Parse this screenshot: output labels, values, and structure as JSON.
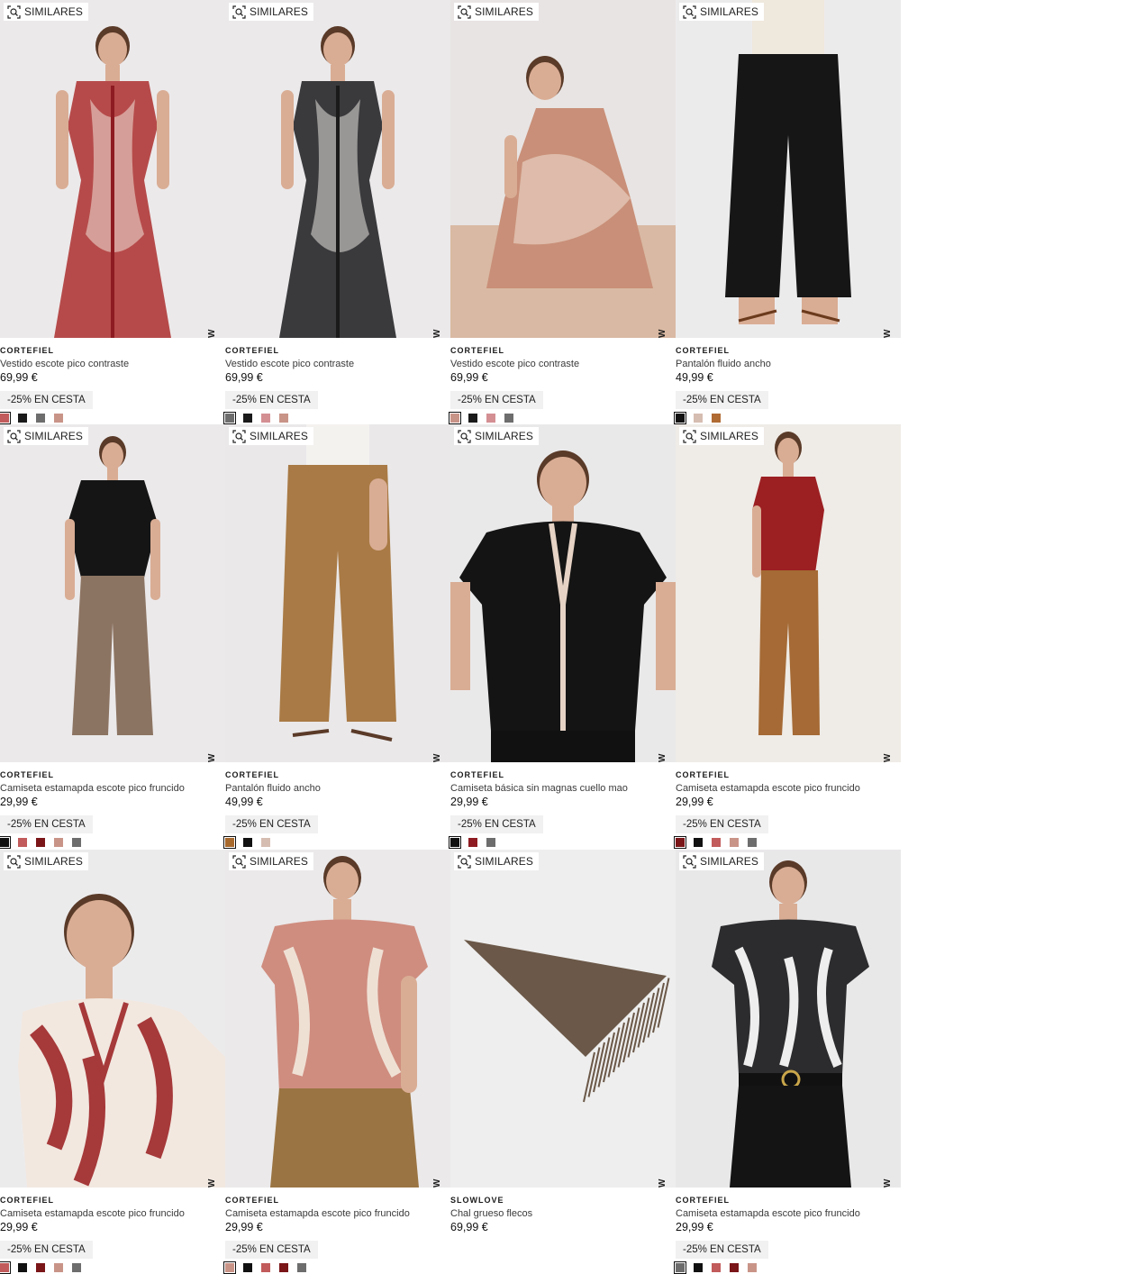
{
  "common": {
    "similar_label": "SIMILARES",
    "new_label": "NEW",
    "promo_label": "-25% EN CESTA"
  },
  "products": [
    {
      "brand": "CORTEFIEL",
      "name": "Vestido escote pico contraste",
      "price": "69,99 €",
      "promo": true,
      "scene": {
        "bg": "#ece9ea",
        "garment": "dress-red-print",
        "main": "#b64a4a",
        "second": "#f1e3d8"
      },
      "swatches": [
        "#c25b5b",
        "#1a1a1a",
        "#6d6d6d",
        "#c99488"
      ]
    },
    {
      "brand": "CORTEFIEL",
      "name": "Vestido escote pico contraste",
      "price": "69,99 €",
      "promo": true,
      "scene": {
        "bg": "#ebe9ea",
        "garment": "dress-black-print",
        "main": "#3a3a3d",
        "second": "#e8e4de"
      },
      "swatches": [
        "#6d6d6d",
        "#1a1a1a",
        "#d48f93",
        "#c99488"
      ]
    },
    {
      "brand": "CORTEFIEL",
      "name": "Vestido escote pico contraste",
      "price": "69,99 €",
      "promo": true,
      "scene": {
        "bg": "#e8e4e3",
        "garment": "dress-crouch",
        "main": "#c98f78",
        "second": "#efe0d4"
      },
      "swatches": [
        "#c99488",
        "#1a1a1a",
        "#d48f93",
        "#6d6d6d"
      ]
    },
    {
      "brand": "CORTEFIEL",
      "name": "Pantalón fluido ancho",
      "price": "49,99 €",
      "promo": true,
      "scene": {
        "bg": "#ecebec",
        "garment": "pants-black",
        "main": "#161616",
        "second": "#efe8dc"
      },
      "swatches": [
        "#111111",
        "#d6bdb1",
        "#b06b33"
      ]
    },
    {
      "brand": "CORTEFIEL",
      "name": "Camiseta estamapda escote pico fruncido",
      "price": "29,99 €",
      "promo": true,
      "scene": {
        "bg": "#ebe9ea",
        "garment": "top-black-pants-taupe",
        "main": "#151515",
        "second": "#8c7462"
      },
      "swatches": [
        "#111111",
        "#c25b5b",
        "#7a1518",
        "#c99488",
        "#6d6d6d"
      ]
    },
    {
      "brand": "CORTEFIEL",
      "name": "Pantalón fluido ancho",
      "price": "49,99 €",
      "promo": true,
      "scene": {
        "bg": "#eae8e9",
        "garment": "pants-camel",
        "main": "#a97a45",
        "second": "#f4f2ef"
      },
      "swatches": [
        "#a8692d",
        "#111111",
        "#d6bdb1"
      ]
    },
    {
      "brand": "CORTEFIEL",
      "name": "Camiseta básica sin magnas cuello mao",
      "price": "29,99 €",
      "promo": true,
      "scene": {
        "bg": "#eae9ea",
        "garment": "tee-black-trim",
        "main": "#141414",
        "second": "#e6d3c5"
      },
      "swatches": [
        "#111111",
        "#8e1b21",
        "#6d6d6d"
      ]
    },
    {
      "brand": "CORTEFIEL",
      "name": "Camiseta estamapda escote pico fruncido",
      "price": "29,99 €",
      "promo": true,
      "scene": {
        "bg": "#efebe6",
        "garment": "top-red-pants-rust",
        "main": "#9c1f22",
        "second": "#a56a35"
      },
      "swatches": [
        "#7a1518",
        "#111111",
        "#c25b5b",
        "#c99488",
        "#6d6d6d"
      ]
    },
    {
      "brand": "CORTEFIEL",
      "name": "Camiseta estamapda escote pico fruncido",
      "price": "29,99 €",
      "promo": true,
      "scene": {
        "bg": "#ecebec",
        "garment": "top-red-closeup",
        "main": "#a6393a",
        "second": "#f2e8e0"
      },
      "swatches": [
        "#c25b5b",
        "#111111",
        "#7a1518",
        "#c99488",
        "#6d6d6d"
      ]
    },
    {
      "brand": "CORTEFIEL",
      "name": "Camiseta estamapda escote pico fruncido",
      "price": "29,99 €",
      "promo": true,
      "scene": {
        "bg": "#ebe9ea",
        "garment": "top-pink-print",
        "main": "#cf8d7f",
        "second": "#9a7442"
      },
      "swatches": [
        "#c99488",
        "#111111",
        "#c25b5b",
        "#7a1518",
        "#6d6d6d"
      ]
    },
    {
      "brand": "SLOWLOVE",
      "name": "Chal grueso flecos",
      "price": "69,99 €",
      "promo": false,
      "scene": {
        "bg": "#eeeeee",
        "garment": "scarf",
        "main": "#6b5848",
        "second": "#e5e5e5"
      },
      "swatches": []
    },
    {
      "brand": "CORTEFIEL",
      "name": "Camiseta estamapda escote pico fruncido",
      "price": "29,99 €",
      "promo": true,
      "scene": {
        "bg": "#e9e8e9",
        "garment": "top-bw-print",
        "main": "#2c2c2e",
        "second": "#efeeee"
      },
      "swatches": [
        "#6d6d6d",
        "#111111",
        "#c25b5b",
        "#7a1518",
        "#c99488"
      ]
    }
  ]
}
